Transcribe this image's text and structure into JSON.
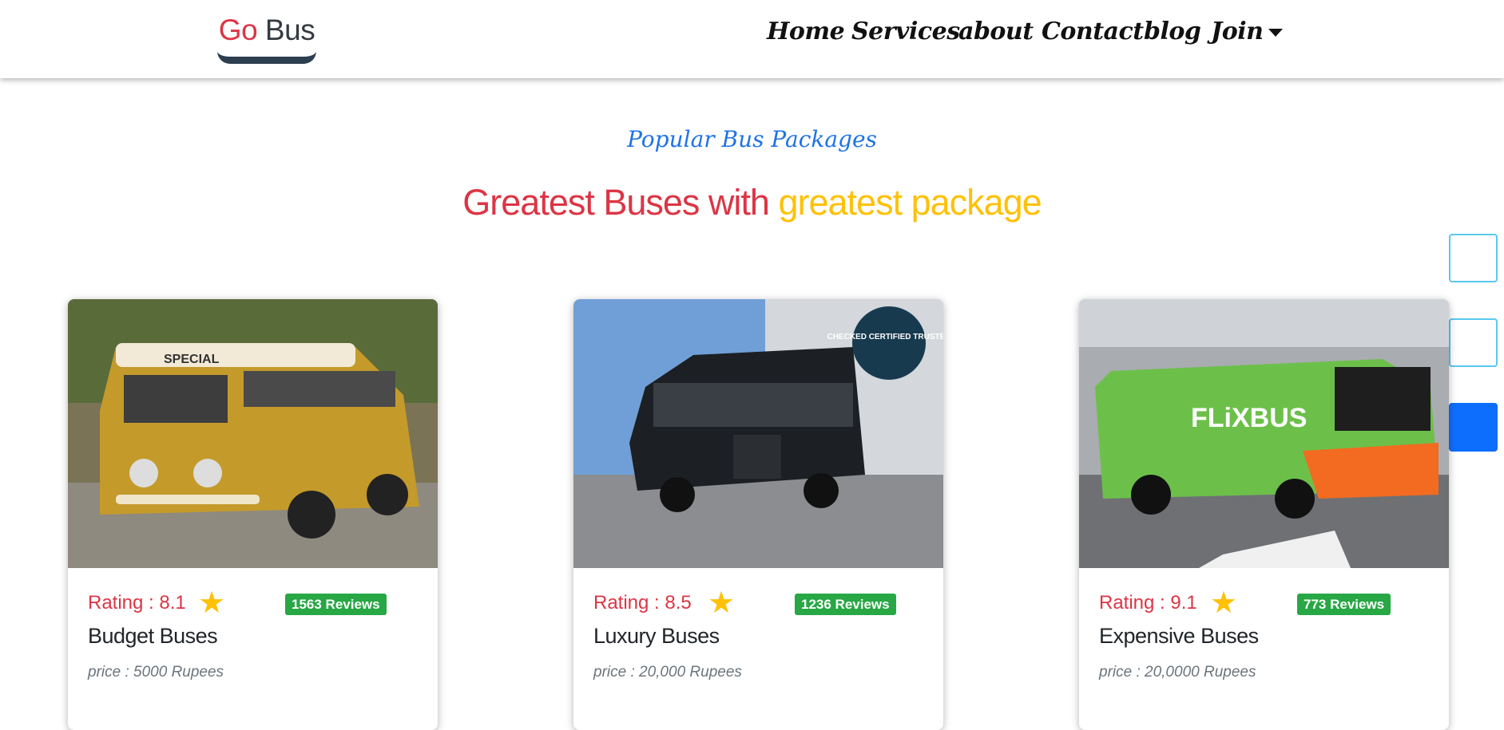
{
  "brand": {
    "go": "Go",
    "bus": " Bus"
  },
  "nav": {
    "items": [
      "Home",
      "Services",
      "about",
      "Contact",
      "blog",
      "Join"
    ]
  },
  "section": {
    "subtitle": "Popular Bus Packages",
    "title_red": "Greatest Buses with ",
    "title_yellow": "greatest package"
  },
  "cards": [
    {
      "rating": "Rating : 8.1",
      "reviews": "1563 Reviews",
      "title": "Budget Buses",
      "price": "price : 5000 Rupees",
      "image_label": "SPECIAL"
    },
    {
      "rating": "Rating : 8.5",
      "reviews": "1236 Reviews",
      "title": "Luxury Buses",
      "price": "price : 20,000 Rupees",
      "image_label": "CHECKED CERTIFIED TRUSTED"
    },
    {
      "rating": "Rating : 9.1",
      "reviews": "773 Reviews",
      "title": "Expensive Buses",
      "price": "price : 20,0000 Rupees",
      "image_label": "FLiXBUS"
    }
  ],
  "icons": {
    "star": "star-icon",
    "caret": "caret-down-icon"
  },
  "colors": {
    "brand_red": "#dc3545",
    "accent_yellow": "#ffc107",
    "subtitle_blue": "#1e73e8",
    "review_green": "#28a745",
    "side_active": "#0d6efd"
  }
}
